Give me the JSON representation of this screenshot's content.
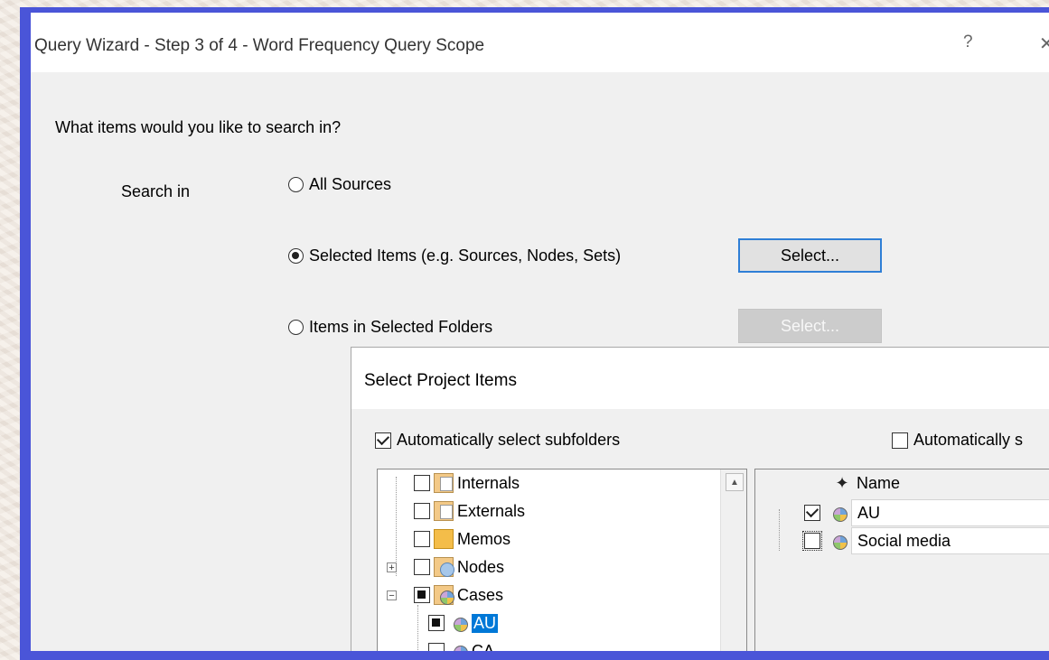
{
  "wizard": {
    "title": "Query Wizard - Step 3 of 4 - Word Frequency Query Scope",
    "help_glyph": "?",
    "close_glyph": "✕",
    "question": "What items would you like to search in?",
    "search_in_label": "Search in",
    "options": [
      {
        "label": "All Sources",
        "selected": false
      },
      {
        "label": "Selected Items (e.g. Sources, Nodes, Sets)",
        "selected": true
      },
      {
        "label": "Items in Selected Folders",
        "selected": false
      }
    ],
    "select_button_label": "Select...",
    "select_button_disabled_label": "Select..."
  },
  "select_dialog": {
    "title": "Select Project Items",
    "auto_subfolders_label": "Automatically select subfolders",
    "auto_subfolders_checked": true,
    "auto_select_label": "Automatically s",
    "auto_select_checked": false,
    "tree": [
      {
        "label": "Internals",
        "icon": "internals-folder-icon",
        "state": "unchecked"
      },
      {
        "label": "Externals",
        "icon": "externals-folder-icon",
        "state": "unchecked"
      },
      {
        "label": "Memos",
        "icon": "memos-folder-icon",
        "state": "unchecked"
      },
      {
        "label": "Nodes",
        "icon": "nodes-folder-icon",
        "state": "unchecked",
        "expander": "+"
      },
      {
        "label": "Cases",
        "icon": "cases-folder-icon",
        "state": "partial",
        "expander": "−"
      },
      {
        "label": "AU",
        "icon": "case-icon",
        "state": "partial",
        "highlighted": true
      },
      {
        "label": "CA",
        "icon": "case-icon",
        "state": "unchecked"
      }
    ],
    "grid": {
      "name_header": "Name",
      "rows": [
        {
          "name": "AU",
          "checked": true
        },
        {
          "name": "Social media",
          "checked": false
        }
      ]
    }
  }
}
